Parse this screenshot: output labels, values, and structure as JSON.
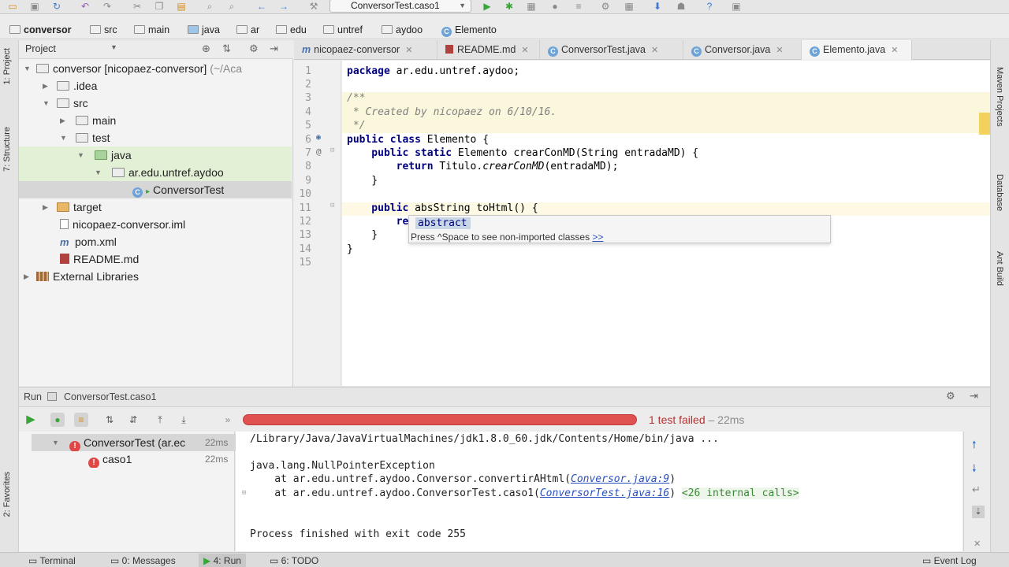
{
  "toolbar": {
    "run_config": "ConversorTest.caso1",
    "icons": [
      "open-icon",
      "save-icon",
      "sync-icon",
      "undo-icon",
      "redo-icon",
      "cut-icon",
      "copy-icon",
      "paste-icon",
      "find-icon",
      "replace-icon",
      "back-icon",
      "forward-icon",
      "build-icon",
      "run-icon",
      "debug-icon",
      "coverage-icon",
      "profile-icon",
      "stop-icon",
      "settings-icon",
      "project-structure-icon",
      "sdk-icon",
      "android-icon",
      "help-icon",
      "ide-icon"
    ]
  },
  "breadcrumb": [
    "conversor",
    "src",
    "main",
    "java",
    "ar",
    "edu",
    "untref",
    "aydoo",
    "Elemento"
  ],
  "project_panel": {
    "title": "Project",
    "tree": [
      {
        "label": "conversor [nicopaez-conversor]",
        "suffix": "(~/Aca"
      },
      {
        "label": ".idea"
      },
      {
        "label": "src"
      },
      {
        "label": "main"
      },
      {
        "label": "test"
      },
      {
        "label": "java"
      },
      {
        "label": "ar.edu.untref.aydoo"
      },
      {
        "label": "ConversorTest"
      },
      {
        "label": "target"
      },
      {
        "label": "nicopaez-conversor.iml"
      },
      {
        "label": "pom.xml"
      },
      {
        "label": "README.md"
      },
      {
        "label": "External Libraries"
      }
    ]
  },
  "left_strip": {
    "project": "1: Project",
    "structure": "7: Structure",
    "favorites": "2: Favorites"
  },
  "right_strip": {
    "maven": "Maven Projects",
    "database": "Database",
    "ant": "Ant Build"
  },
  "editor_tabs": [
    {
      "label": "nicopaez-conversor",
      "active": false
    },
    {
      "label": "README.md",
      "active": false
    },
    {
      "label": "ConversorTest.java",
      "active": false
    },
    {
      "label": "Conversor.java",
      "active": false
    },
    {
      "label": "Elemento.java",
      "active": true
    }
  ],
  "editor": {
    "line_numbers": [
      "1",
      "2",
      "3",
      "4",
      "5",
      "6",
      "7",
      "8",
      "9",
      "10",
      "11",
      "12",
      "13",
      "14",
      "15"
    ],
    "lines": {
      "l1_kw": "package",
      "l1_rest": " ar.edu.untref.aydoo;",
      "l3": "/**",
      "l4": " * Created by nicopaez on 6/10/16.",
      "l5": " */",
      "l6_kw": "public class",
      "l6_rest": " Elemento {",
      "l7_kw": "    public static",
      "l7_rest": " Elemento crearConMD(String entradaMD) {",
      "l8_kw": "        return",
      "l8_rest": " Titulo.",
      "l8_italic": "crearConMD",
      "l8_end": "(entradaMD);",
      "l9": "    }",
      "l11_kw": "    public",
      "l11_rest": " absString toHtml() {",
      "l12": "        re",
      "l13": "    }",
      "l14": "}"
    },
    "autocomplete": {
      "item": "abstract",
      "hint": "Press ^Space to see non-imported classes ",
      "hint_link": ">>"
    }
  },
  "run_panel": {
    "label": "Run",
    "config": "ConversorTest.caso1",
    "status": "1 test failed",
    "status_time": " – 22ms",
    "progress_fraction": 1.0,
    "tests": [
      {
        "name": "ConversorTest (ar.ec",
        "time": "22ms"
      },
      {
        "name": "caso1",
        "time": "22ms"
      }
    ],
    "console": {
      "l1": "/Library/Java/JavaVirtualMachines/jdk1.8.0_60.jdk/Contents/Home/bin/java ...",
      "l2": "java.lang.NullPointerException",
      "l3_pre": "    at ar.edu.untref.aydoo.Conversor.convertirAHtml(",
      "l3_link": "Conversor.java:9",
      "l3_post": ")",
      "l4_pre": "    at ar.edu.untref.aydoo.ConversorTest.caso1(",
      "l4_link": "ConversorTest.java:16",
      "l4_post": ") ",
      "l4_internal": "<26 internal calls>",
      "l5": "Process finished with exit code 255"
    }
  },
  "bottom_tabs": [
    "Terminal",
    "0: Messages",
    "4: Run",
    "6: TODO",
    "Event Log"
  ],
  "colors": {
    "error": "#e04848",
    "accent": "#3a7bd5",
    "keyword": "#000080"
  }
}
